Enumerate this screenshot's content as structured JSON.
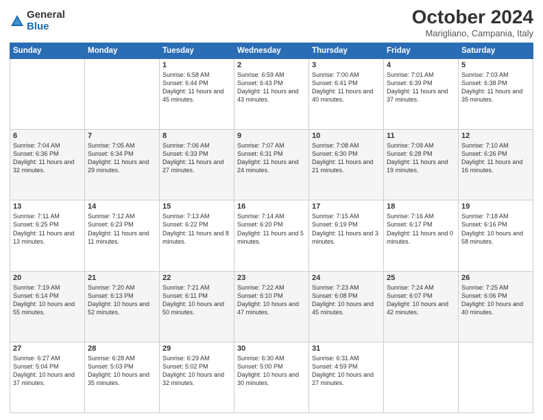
{
  "header": {
    "logo_general": "General",
    "logo_blue": "Blue",
    "month_title": "October 2024",
    "location": "Marigliano, Campania, Italy"
  },
  "days_of_week": [
    "Sunday",
    "Monday",
    "Tuesday",
    "Wednesday",
    "Thursday",
    "Friday",
    "Saturday"
  ],
  "weeks": [
    [
      {
        "day": "",
        "content": ""
      },
      {
        "day": "",
        "content": ""
      },
      {
        "day": "1",
        "content": "Sunrise: 6:58 AM\nSunset: 6:44 PM\nDaylight: 11 hours and 45 minutes."
      },
      {
        "day": "2",
        "content": "Sunrise: 6:59 AM\nSunset: 6:43 PM\nDaylight: 11 hours and 43 minutes."
      },
      {
        "day": "3",
        "content": "Sunrise: 7:00 AM\nSunset: 6:41 PM\nDaylight: 11 hours and 40 minutes."
      },
      {
        "day": "4",
        "content": "Sunrise: 7:01 AM\nSunset: 6:39 PM\nDaylight: 11 hours and 37 minutes."
      },
      {
        "day": "5",
        "content": "Sunrise: 7:03 AM\nSunset: 6:38 PM\nDaylight: 11 hours and 35 minutes."
      }
    ],
    [
      {
        "day": "6",
        "content": "Sunrise: 7:04 AM\nSunset: 6:36 PM\nDaylight: 11 hours and 32 minutes."
      },
      {
        "day": "7",
        "content": "Sunrise: 7:05 AM\nSunset: 6:34 PM\nDaylight: 11 hours and 29 minutes."
      },
      {
        "day": "8",
        "content": "Sunrise: 7:06 AM\nSunset: 6:33 PM\nDaylight: 11 hours and 27 minutes."
      },
      {
        "day": "9",
        "content": "Sunrise: 7:07 AM\nSunset: 6:31 PM\nDaylight: 11 hours and 24 minutes."
      },
      {
        "day": "10",
        "content": "Sunrise: 7:08 AM\nSunset: 6:30 PM\nDaylight: 11 hours and 21 minutes."
      },
      {
        "day": "11",
        "content": "Sunrise: 7:09 AM\nSunset: 6:28 PM\nDaylight: 11 hours and 19 minutes."
      },
      {
        "day": "12",
        "content": "Sunrise: 7:10 AM\nSunset: 6:26 PM\nDaylight: 11 hours and 16 minutes."
      }
    ],
    [
      {
        "day": "13",
        "content": "Sunrise: 7:11 AM\nSunset: 6:25 PM\nDaylight: 11 hours and 13 minutes."
      },
      {
        "day": "14",
        "content": "Sunrise: 7:12 AM\nSunset: 6:23 PM\nDaylight: 11 hours and 11 minutes."
      },
      {
        "day": "15",
        "content": "Sunrise: 7:13 AM\nSunset: 6:22 PM\nDaylight: 11 hours and 8 minutes."
      },
      {
        "day": "16",
        "content": "Sunrise: 7:14 AM\nSunset: 6:20 PM\nDaylight: 11 hours and 5 minutes."
      },
      {
        "day": "17",
        "content": "Sunrise: 7:15 AM\nSunset: 6:19 PM\nDaylight: 11 hours and 3 minutes."
      },
      {
        "day": "18",
        "content": "Sunrise: 7:16 AM\nSunset: 6:17 PM\nDaylight: 11 hours and 0 minutes."
      },
      {
        "day": "19",
        "content": "Sunrise: 7:18 AM\nSunset: 6:16 PM\nDaylight: 10 hours and 58 minutes."
      }
    ],
    [
      {
        "day": "20",
        "content": "Sunrise: 7:19 AM\nSunset: 6:14 PM\nDaylight: 10 hours and 55 minutes."
      },
      {
        "day": "21",
        "content": "Sunrise: 7:20 AM\nSunset: 6:13 PM\nDaylight: 10 hours and 52 minutes."
      },
      {
        "day": "22",
        "content": "Sunrise: 7:21 AM\nSunset: 6:11 PM\nDaylight: 10 hours and 50 minutes."
      },
      {
        "day": "23",
        "content": "Sunrise: 7:22 AM\nSunset: 6:10 PM\nDaylight: 10 hours and 47 minutes."
      },
      {
        "day": "24",
        "content": "Sunrise: 7:23 AM\nSunset: 6:08 PM\nDaylight: 10 hours and 45 minutes."
      },
      {
        "day": "25",
        "content": "Sunrise: 7:24 AM\nSunset: 6:07 PM\nDaylight: 10 hours and 42 minutes."
      },
      {
        "day": "26",
        "content": "Sunrise: 7:25 AM\nSunset: 6:06 PM\nDaylight: 10 hours and 40 minutes."
      }
    ],
    [
      {
        "day": "27",
        "content": "Sunrise: 6:27 AM\nSunset: 5:04 PM\nDaylight: 10 hours and 37 minutes."
      },
      {
        "day": "28",
        "content": "Sunrise: 6:28 AM\nSunset: 5:03 PM\nDaylight: 10 hours and 35 minutes."
      },
      {
        "day": "29",
        "content": "Sunrise: 6:29 AM\nSunset: 5:02 PM\nDaylight: 10 hours and 32 minutes."
      },
      {
        "day": "30",
        "content": "Sunrise: 6:30 AM\nSunset: 5:00 PM\nDaylight: 10 hours and 30 minutes."
      },
      {
        "day": "31",
        "content": "Sunrise: 6:31 AM\nSunset: 4:59 PM\nDaylight: 10 hours and 27 minutes."
      },
      {
        "day": "",
        "content": ""
      },
      {
        "day": "",
        "content": ""
      }
    ]
  ]
}
